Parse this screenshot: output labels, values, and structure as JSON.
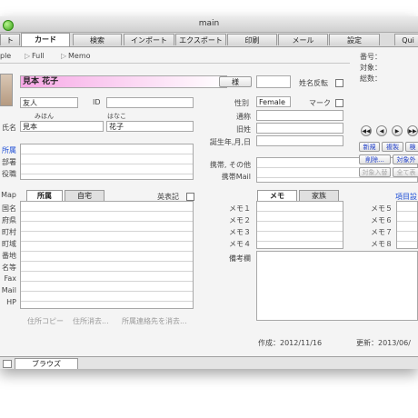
{
  "window": {
    "title": "main"
  },
  "tabs": [
    "ト",
    "カード",
    "検索",
    "インポート",
    "エクスポート",
    "印刷",
    "メール",
    "設定",
    "Qui"
  ],
  "view_modes": [
    "ple",
    "Full",
    "Memo"
  ],
  "record": {
    "number_label": "番号：",
    "target_label": "対象：",
    "total_label": "総数："
  },
  "name": {
    "full_name": "見本 花子",
    "title_button": "様",
    "reverse_label": "姓名反転",
    "friend": "友人",
    "id_label": "ID",
    "kana_last": "みほん",
    "kana_first": "はなこ",
    "name_label": "氏名",
    "last_name": "見本",
    "first_name": "花子"
  },
  "left_labels": {
    "affiliation": "所属",
    "department": "部署",
    "position": "役職",
    "map": "Map",
    "country": "国名",
    "prefecture": "府県",
    "city": "町村",
    "town": "町域",
    "address": "番地",
    "building": "名等",
    "fax": "Fax",
    "mail": "Mail",
    "hp": "HP"
  },
  "address_tabs": {
    "work": "所属",
    "home": "自宅",
    "english": "英表記"
  },
  "address_buttons": {
    "copy": "住所コピー",
    "clear": "住所消去...",
    "contact": "所属連絡先を消去..."
  },
  "personal": {
    "gender_label": "性別",
    "gender_value": "Female",
    "mark_label": "マーク",
    "title_label": "通称",
    "maiden_label": "旧姓",
    "birthday_label": "誕生年,月,日",
    "mobile_label": "携帯, その他",
    "mobile_mail_label": "携帯Mail"
  },
  "nav_buttons": [
    "◀◀",
    "◀",
    "▶",
    "▶▶"
  ],
  "action_buttons": {
    "new": "新規",
    "duplicate": "複製",
    "search": "検",
    "delete": "削除...",
    "target_out": "対象外",
    "target_in": "対象入替",
    "all": "全て表"
  },
  "memo": {
    "tab_memo": "メモ",
    "tab_family": "家族",
    "item_settings": "項目設",
    "left_memos": [
      "メモ１",
      "メモ２",
      "メモ３",
      "メモ４"
    ],
    "right_memos": [
      "メモ５",
      "メモ６",
      "メモ７",
      "メモ８"
    ],
    "remarks_label": "備考欄"
  },
  "footer": {
    "created": "作成：2012/11/16",
    "updated": "更新：2013/06/",
    "mode": "ブラウズ"
  }
}
